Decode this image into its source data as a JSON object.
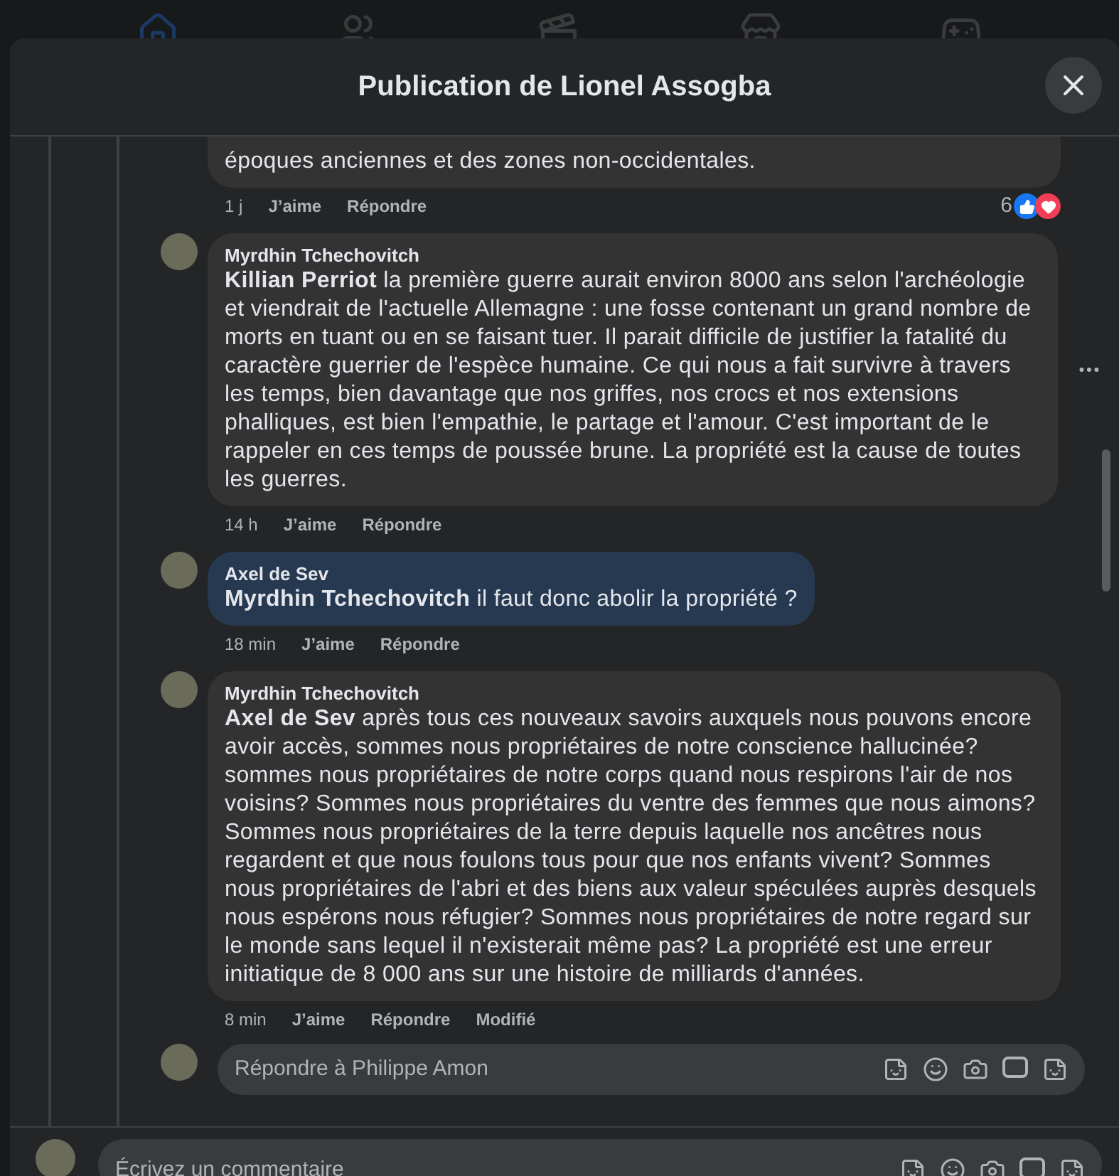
{
  "window": {
    "title": "Publication de Lionel Assogba"
  },
  "comments": [
    {
      "text": "époques anciennes et des zones non-occidentales.",
      "highlighted": false,
      "time": "1 j",
      "actions": [
        "J’aime",
        "Répondre"
      ],
      "reaction_count": "6"
    },
    {
      "author": "Myrdhin Tchechovitch",
      "mention": "Killian Perriot",
      "text": " la première guerre aurait environ 8000 ans selon l'archéologie et viendrait de l'actuelle Allemagne : une fosse contenant un grand nombre de morts en tuant ou en se faisant tuer. Il parait difficile de justifier la fatalité du caractère guerrier de l'espèce humaine. Ce qui nous a fait survivre à travers les temps, bien davantage que nos griffes, nos crocs et nos extensions phalliques, est bien l'empathie, le partage et l'amour. C'est important de le rappeler en ces temps de poussée brune. La propriété est la cause de toutes les guerres.",
      "highlighted": false,
      "time": "14 h",
      "actions": [
        "J’aime",
        "Répondre"
      ],
      "more_menu": true
    },
    {
      "author": "Axel de Sev",
      "mention": "Myrdhin Tchechovitch",
      "text": " il faut donc abolir la propriété ?",
      "highlighted": true,
      "time": "18 min",
      "actions": [
        "J’aime",
        "Répondre"
      ]
    },
    {
      "author": "Myrdhin Tchechovitch",
      "mention": "Axel de Sev",
      "text": " après tous ces nouveaux savoirs auxquels nous pouvons encore avoir accès, sommes nous propriétaires de notre conscience hallucinée? sommes nous propriétaires de notre corps quand nous respirons l'air de nos voisins? Sommes nous propriétaires du ventre des femmes que nous aimons? Sommes nous propriétaires de la terre depuis laquelle nos ancêtres nous regardent et que nous foulons tous pour que nos enfants vivent? Sommes nous propriétaires de l'abri et des biens aux valeur spéculées auprès desquels nous espérons nous réfugier? Sommes nous propriétaires de notre regard sur le monde sans lequel il n'existerait même pas? La propriété est une erreur initiatique de 8 000 ans sur une histoire de milliards d'années.",
      "highlighted": false,
      "time": "8 min",
      "actions": [
        "J’aime",
        "Répondre"
      ],
      "edited": "Modifié"
    }
  ],
  "reply_field": {
    "placeholder": "Répondre à Philippe Amon"
  },
  "comment_field": {
    "placeholder": "Écrivez un commentaire"
  }
}
